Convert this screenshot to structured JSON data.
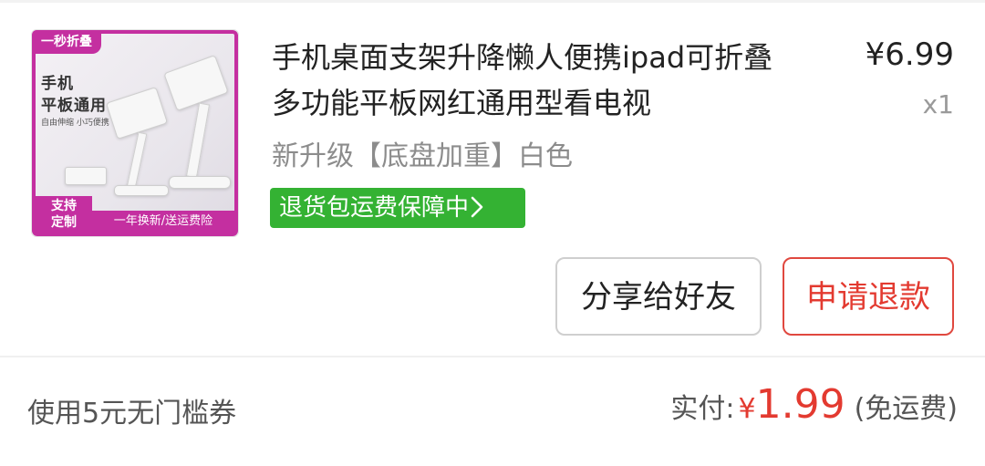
{
  "thumbnail": {
    "badge": "一秒折叠",
    "title_line1": "手机",
    "title_line2": "平板通用",
    "subtitle": "自由伸缩 小巧便携",
    "custom_label_line1": "支持",
    "custom_label_line2": "定制",
    "bottom_label": "一年换新/送运费险",
    "accent_color": "#c42fa0"
  },
  "product": {
    "title_line1": "手机桌面支架升降懒人便携ipad可折叠",
    "title_line2": "多功能平板网红通用型看电视",
    "price": "¥6.99",
    "quantity": "x1",
    "variant": "新升级【底盘加重】白色",
    "return_badge": "退货包运费保障中",
    "return_badge_icon": "chevron-right-icon"
  },
  "actions": {
    "share_label": "分享给好友",
    "refund_label": "申请退款"
  },
  "summary": {
    "coupon": "使用5元无门槛券",
    "paid_label": "实付:",
    "currency": "¥",
    "paid_amount": "1.99",
    "shipping_note": "(免运费)"
  },
  "colors": {
    "accent_red": "#e33a30",
    "return_green": "#34b233"
  }
}
